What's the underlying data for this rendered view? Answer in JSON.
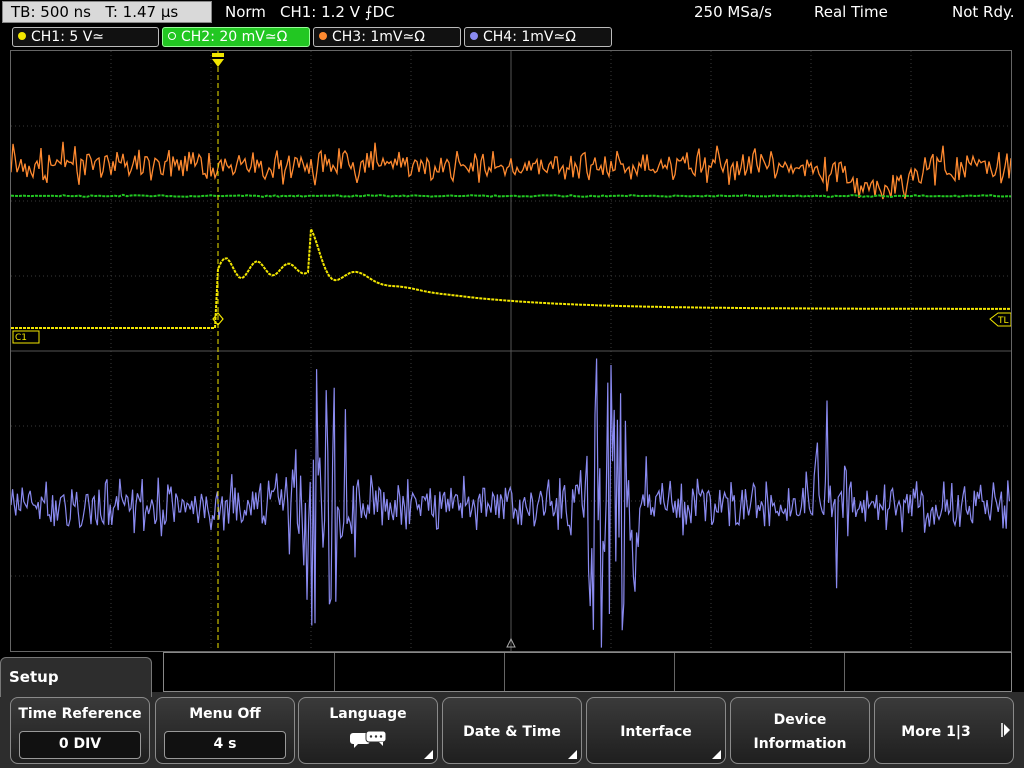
{
  "status": {
    "tb": "TB: 500 ns",
    "trig_pos": "T: 1.47 µs",
    "trig_mode": "Norm",
    "trig_source": "CH1: 1.2 V ⨍DC",
    "sample_rate": "250 MSa/s",
    "acq_mode": "Real Time",
    "state": "Not Rdy."
  },
  "channels": [
    {
      "label": "CH1: 5 V≃",
      "color": "#f2e600",
      "active": false
    },
    {
      "label": "CH2: 20 mV≃Ω",
      "color": "#22c722",
      "active": true
    },
    {
      "label": "CH3: 1mV≃Ω",
      "color": "#ff8a30",
      "active": false
    },
    {
      "label": "CH4: 1mV≃Ω",
      "color": "#8a8af0",
      "active": false
    }
  ],
  "markers": {
    "ch1": "C1",
    "trigger_level": "TL"
  },
  "menu": {
    "title": "Setup",
    "softkeys": [
      {
        "label": "Time Reference",
        "value": "0 DIV"
      },
      {
        "label": "Menu Off",
        "value": "4 s"
      },
      {
        "label": "Language",
        "icon": "speech-bubble-icon"
      },
      {
        "label": "Date & Time"
      },
      {
        "label": "Interface"
      },
      {
        "label1": "Device",
        "label2": "Information"
      },
      {
        "label": "More 1|3"
      }
    ]
  },
  "colors": {
    "ch1": "#f2e600",
    "ch2": "#22c722",
    "ch3": "#ff8a30",
    "ch4": "#8a8af0",
    "grid": "#555555"
  }
}
